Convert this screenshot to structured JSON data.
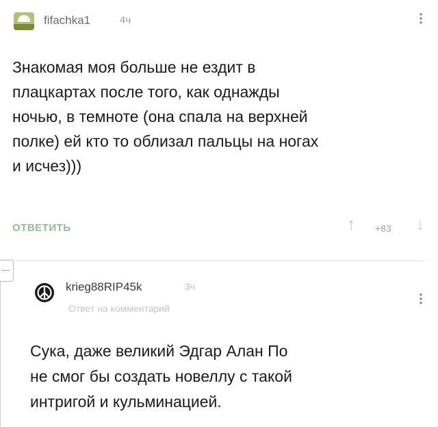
{
  "comment": {
    "username": "fifachka1",
    "time": "4ч",
    "text": "Знакомая моя больше не ездит в\nплацкартах после того, как однажды\nночью, в темноте (она спала на верхней\nполке) ей кто то облизал пальцы на ногах\nи исчез)))",
    "reply_label": "ОТВЕТИТЬ",
    "rating": "+83",
    "avatar_icon": "landscape-avatar-icon",
    "menu_icon": "vertical-dots-icon"
  },
  "reply": {
    "username": "krieg88RIP45k",
    "time": "3ч",
    "reply_to": "Ответ на комментарий",
    "text": "Сука, даже великий Эдгар Алан По\nне смог бы создать новеллу с такой\nинтригой и кульминацией.",
    "avatar_icon": "peace-sign-avatar-icon",
    "menu_icon": "vertical-dots-icon"
  },
  "colors": {
    "reply_button": "#8fbf8f",
    "text": "#1a1a1a",
    "muted": "#9a9a9a"
  }
}
